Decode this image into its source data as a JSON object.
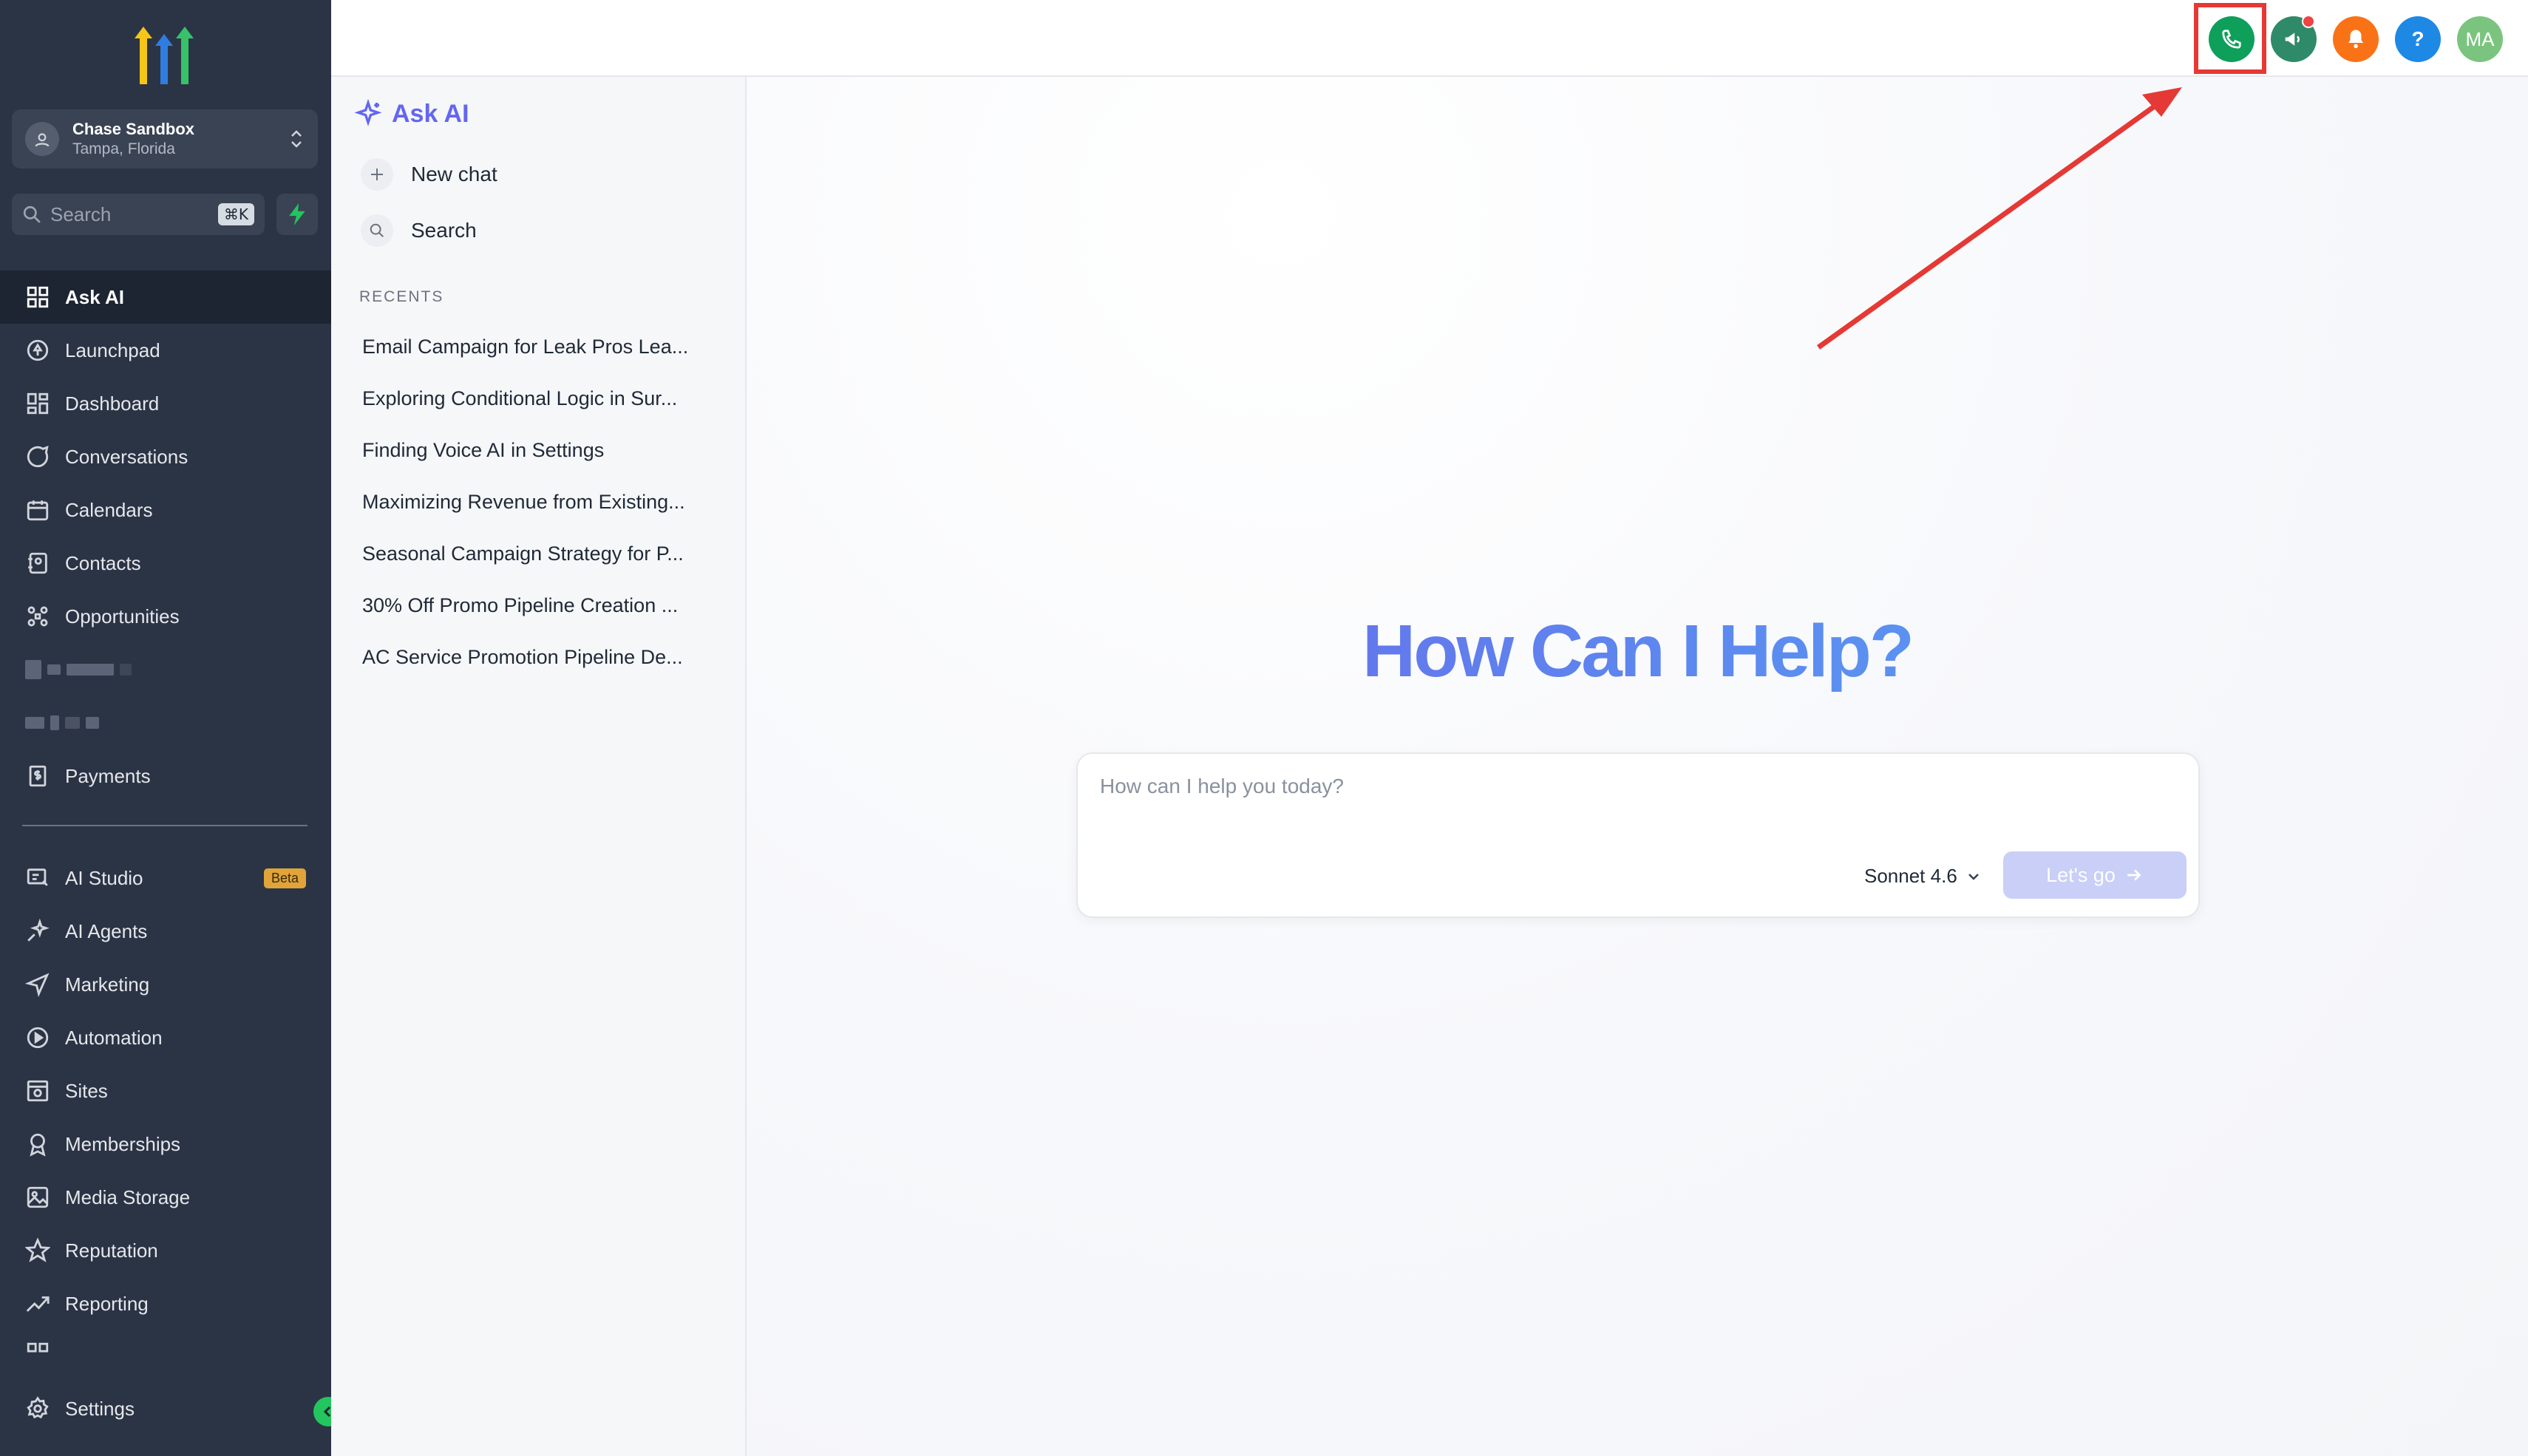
{
  "account": {
    "name": "Chase Sandbox",
    "location": "Tampa, Florida"
  },
  "search": {
    "label": "Search",
    "shortcut": "⌘K"
  },
  "nav": {
    "items": [
      {
        "label": "Ask AI",
        "icon": "grid-icon"
      },
      {
        "label": "Launchpad",
        "icon": "rocket-icon"
      },
      {
        "label": "Dashboard",
        "icon": "dashboard-icon"
      },
      {
        "label": "Conversations",
        "icon": "chat-bubble-icon"
      },
      {
        "label": "Calendars",
        "icon": "calendar-icon"
      },
      {
        "label": "Contacts",
        "icon": "contacts-icon"
      },
      {
        "label": "Opportunities",
        "icon": "opportunities-icon"
      }
    ],
    "payments": "Payments",
    "secondary": [
      {
        "label": "AI Studio",
        "icon": "ai-studio-icon",
        "badge": "Beta"
      },
      {
        "label": "AI Agents",
        "icon": "sparkle-icon"
      },
      {
        "label": "Marketing",
        "icon": "send-icon"
      },
      {
        "label": "Automation",
        "icon": "automation-icon"
      },
      {
        "label": "Sites",
        "icon": "sites-icon"
      },
      {
        "label": "Memberships",
        "icon": "membership-icon"
      },
      {
        "label": "Media Storage",
        "icon": "image-icon"
      },
      {
        "label": "Reputation",
        "icon": "star-icon"
      },
      {
        "label": "Reporting",
        "icon": "trend-icon"
      }
    ],
    "settings": "Settings"
  },
  "topbar": {
    "avatar_initials": "MA",
    "help_label": "?",
    "colors": {
      "phone": "#0e9f5a",
      "announce": "#2f8a6a",
      "bell": "#f97316",
      "help": "#1e88e5",
      "avatar": "#7bc47f",
      "highlight": "#e53935"
    }
  },
  "ai_panel": {
    "title": "Ask AI",
    "new_chat": "New chat",
    "search": "Search",
    "recents_label": "RECENTS",
    "recents": [
      "Email Campaign for Leak Pros Lea...",
      "Exploring Conditional Logic in Sur...",
      "Finding Voice AI in Settings",
      "Maximizing Revenue from Existing...",
      "Seasonal Campaign Strategy for P...",
      "30% Off Promo Pipeline Creation ...",
      "AC Service Promotion Pipeline De..."
    ]
  },
  "main": {
    "hero": "How Can I Help?",
    "prompt_placeholder": "How can I help you today?",
    "model": "Sonnet 4.6",
    "submit": "Let's go"
  }
}
